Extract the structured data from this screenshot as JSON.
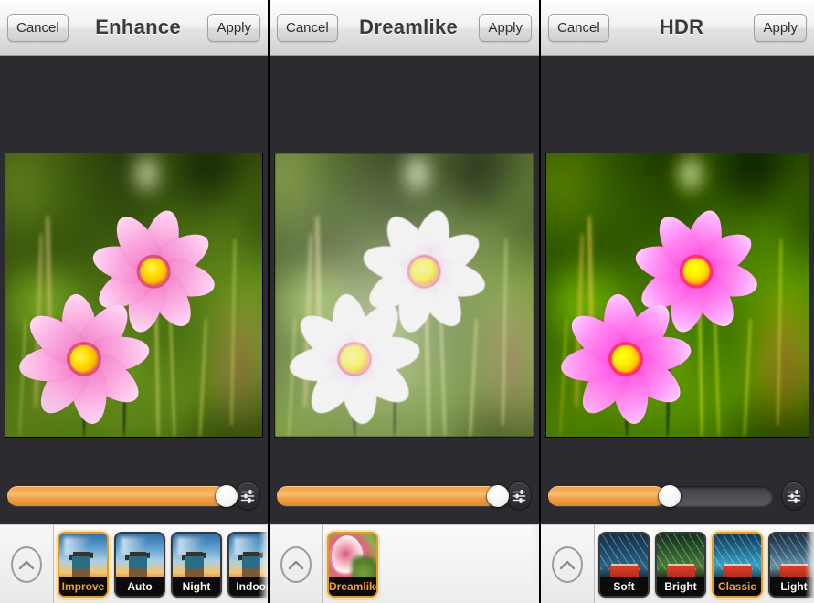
{
  "panels": [
    {
      "id": "enhance",
      "cancel_label": "Cancel",
      "title": "Enhance",
      "apply_label": "Apply",
      "slider": {
        "value": 100,
        "fill_color": "#f0a14a"
      },
      "eq_icon": "equalizer-icon",
      "collapse_icon": "chevron-up-icon",
      "photo": {
        "subject": "two pink cosmos flowers",
        "style": "original"
      },
      "filters": [
        {
          "label": "Improve",
          "selected": true,
          "art": "beach"
        },
        {
          "label": "Auto",
          "selected": false,
          "art": "beach"
        },
        {
          "label": "Night",
          "selected": false,
          "art": "beach"
        },
        {
          "label": "Indoor",
          "selected": false,
          "art": "beach"
        },
        {
          "label": "",
          "selected": false,
          "art": "beach"
        }
      ]
    },
    {
      "id": "dreamlike",
      "cancel_label": "Cancel",
      "title": "Dreamlike",
      "apply_label": "Apply",
      "slider": {
        "value": 100,
        "fill_color": "#f0a14a"
      },
      "eq_icon": "equalizer-icon",
      "collapse_icon": "chevron-up-icon",
      "photo": {
        "subject": "two pink cosmos flowers",
        "style": "dreamlike-soft-glow"
      },
      "filters": [
        {
          "label": "Dreamlike",
          "selected": true,
          "art": "gerbera"
        }
      ]
    },
    {
      "id": "hdr",
      "cancel_label": "Cancel",
      "title": "HDR",
      "apply_label": "Apply",
      "slider": {
        "value": 52,
        "fill_color": "#f0a14a"
      },
      "eq_icon": "equalizer-icon",
      "collapse_icon": "chevron-up-icon",
      "photo": {
        "subject": "two pink cosmos flowers",
        "style": "hdr-saturated"
      },
      "filters": [
        {
          "label": "Soft",
          "selected": false,
          "art": "boat"
        },
        {
          "label": "Bright",
          "selected": false,
          "art": "boat green"
        },
        {
          "label": "Classic",
          "selected": true,
          "art": "boat cyan"
        },
        {
          "label": "Light",
          "selected": false,
          "art": "boat warm"
        },
        {
          "label": "",
          "selected": false,
          "art": "boat"
        }
      ]
    }
  ],
  "colors": {
    "accent": "#e39b28",
    "slider_fill": "#f0a14a",
    "canvas_dark": "#2b2b30",
    "chrome_light": "#ededed"
  }
}
